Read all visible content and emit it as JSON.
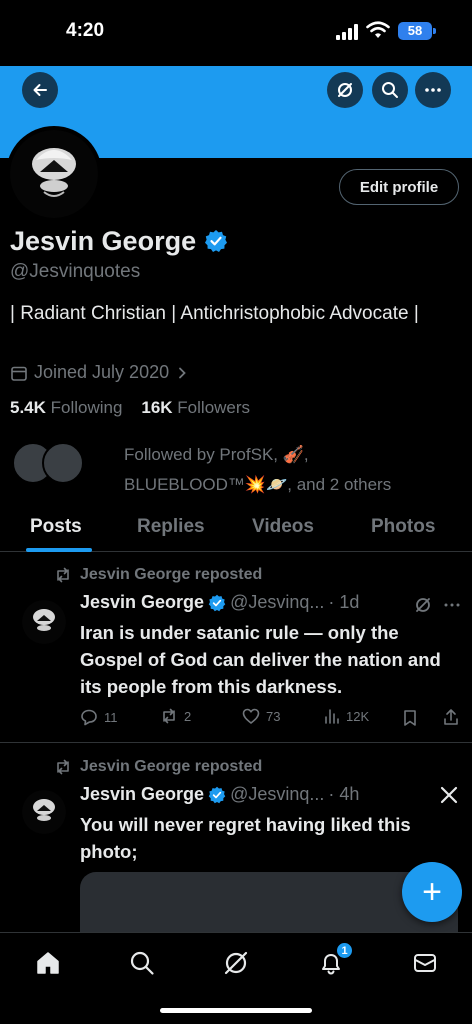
{
  "status_bar": {
    "time": "4:20",
    "battery": "58"
  },
  "colors": {
    "accent": "#1d9bf0",
    "background": "#000000",
    "secondary_text": "#71767b",
    "primary_text": "#e7e9ea"
  },
  "header": {
    "icons": [
      "back-arrow-icon",
      "grok-icon",
      "search-icon",
      "more-icon"
    ]
  },
  "profile": {
    "edit_label": "Edit profile",
    "name": "Jesvin George",
    "handle": "@Jesvinquotes",
    "bio": "| Radiant Christian | Antichristophobic Advocate |",
    "joined": "Joined July 2020",
    "following_count": "5.4K",
    "following_label": "Following",
    "followers_count": "16K",
    "followers_label": "Followers",
    "followed_by_line1": "Followed by ProfSK, 🎻,",
    "followed_by_line2": "BLUEBLOOD™💥🪐, and 2 others"
  },
  "tabs": [
    {
      "label": "Posts",
      "active": true
    },
    {
      "label": "Replies",
      "active": false
    },
    {
      "label": "Videos",
      "active": false
    },
    {
      "label": "Photos",
      "active": false
    }
  ],
  "tweets": [
    {
      "repost_label": "Jesvin George reposted",
      "name": "Jesvin George",
      "handle": "@Jesvinq...",
      "time": "· 1d",
      "text": "Iran is under satanic rule — only the Gospel of God can deliver the nation and its people from this darkness.",
      "replies": "11",
      "reposts": "2",
      "likes": "73",
      "views": "12K"
    },
    {
      "repost_label": "Jesvin George reposted",
      "name": "Jesvin George",
      "handle": "@Jesvinq...",
      "time": "· 4h",
      "text": "You will never regret having liked this photo;"
    }
  ],
  "fab": {
    "label": "+"
  },
  "bottom_nav": {
    "items": [
      "home-icon",
      "search-icon",
      "grok-icon",
      "notifications-icon",
      "messages-icon"
    ],
    "notification_count": "1"
  }
}
